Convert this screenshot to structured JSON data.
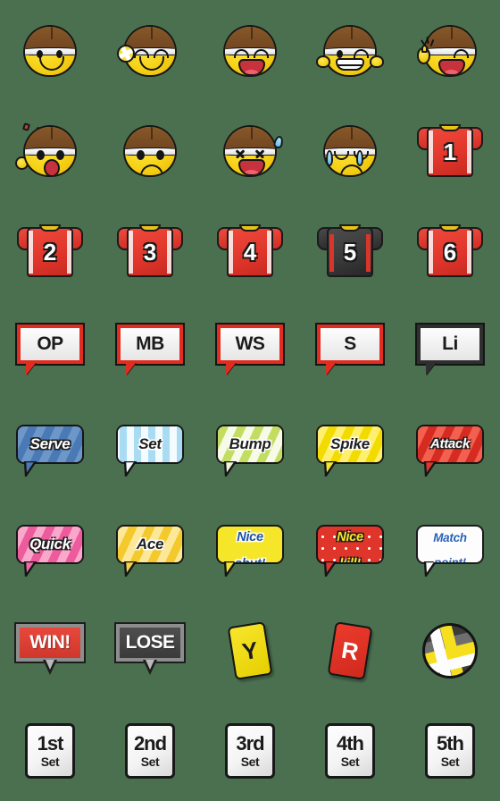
{
  "sheet": {
    "background_color": "#4a7050",
    "columns": 5,
    "rows": 8,
    "theme": "volleyball emoji sticker set"
  },
  "faces": [
    {
      "name": "smiling-player-face",
      "label": "smile"
    },
    {
      "name": "player-face-with-ball",
      "label": "wink with ball"
    },
    {
      "name": "laughing-player-face",
      "label": "laugh"
    },
    {
      "name": "grinning-player-face",
      "label": "grin fists"
    },
    {
      "name": "cheering-player-face",
      "label": "thumbs up wink"
    },
    {
      "name": "shouting-player-face",
      "label": "shout arm up"
    },
    {
      "name": "sad-player-face",
      "label": "sad"
    },
    {
      "name": "dizzy-player-face",
      "label": "dizzy"
    },
    {
      "name": "crying-player-face",
      "label": "cry"
    }
  ],
  "jerseys": [
    {
      "number": "1",
      "color": "red",
      "hex": "#e0352a"
    },
    {
      "number": "2",
      "color": "red",
      "hex": "#e0352a"
    },
    {
      "number": "3",
      "color": "red",
      "hex": "#e0352a"
    },
    {
      "number": "4",
      "color": "red",
      "hex": "#e0352a"
    },
    {
      "number": "5",
      "color": "black",
      "hex": "#3a3a3a"
    },
    {
      "number": "6",
      "color": "red",
      "hex": "#e0352a"
    }
  ],
  "positions": [
    {
      "label": "OP",
      "border": "#e12d20",
      "meaning": "opposite"
    },
    {
      "label": "MB",
      "border": "#e12d20",
      "meaning": "middle blocker"
    },
    {
      "label": "WS",
      "border": "#e12d20",
      "meaning": "wing spiker"
    },
    {
      "label": "S",
      "border": "#e12d20",
      "meaning": "setter"
    },
    {
      "label": "Li",
      "border": "#2f2f2f",
      "meaning": "libero"
    }
  ],
  "actions": [
    {
      "label": "Serve",
      "bg": "#4a7ab5",
      "stripe": "#6d97c9",
      "text": "#ffffff",
      "stripe_dir": "diagonal"
    },
    {
      "label": "Set",
      "bg": "#e9f4fb",
      "stripe": "#a9dcf3",
      "text": "#1f1f1f",
      "stripe_dir": "vertical"
    },
    {
      "label": "Bump",
      "bg": "#f3f8e2",
      "stripe": "#c3dd61",
      "text": "#1f1f1f",
      "stripe_dir": "diagonal"
    },
    {
      "label": "Spike",
      "bg": "#f6e62a",
      "stripe": "#ffef6e",
      "text": "#1f1f1f",
      "stripe_dir": "diagonal"
    },
    {
      "label": "Attack",
      "bg": "#e0352a",
      "stripe": "#f4604f",
      "text": "#ffffff",
      "stripe_dir": "diagonal"
    },
    {
      "label": "Quick",
      "bg": "#f06aa8",
      "stripe": "#f9a8cb",
      "text": "#ffffff",
      "stripe_dir": "diagonal"
    },
    {
      "label": "Ace",
      "bg": "#f6d24a",
      "stripe": "#fde89a",
      "text": "#1f1f1f",
      "stripe_dir": "diagonal"
    }
  ],
  "calls": [
    {
      "line1": "Nice",
      "line2": "shut!",
      "bg": "#f6e62a",
      "text": "#1d52a8",
      "dots": false
    },
    {
      "line1": "Nice",
      "line2": "kill!",
      "bg": "#e0352a",
      "text": "#f6e62a",
      "dots": true
    },
    {
      "line1": "Match",
      "line2": "point!",
      "bg": "#fdfdfd",
      "text": "#2a63b8",
      "dots": false
    }
  ],
  "results": [
    {
      "label": "WIN!",
      "style": "win",
      "bg": "#e8483c"
    },
    {
      "label": "LOSE",
      "style": "lose",
      "bg": "#3a3a3a"
    }
  ],
  "cards": [
    {
      "label": "Y",
      "color": "yellow",
      "hex": "#f8e62c",
      "meaning": "yellow card"
    },
    {
      "label": "R",
      "color": "red",
      "hex": "#ec3b2c",
      "meaning": "red card"
    }
  ],
  "ball": {
    "name": "volleyball",
    "colors": [
      "#3b3b3b",
      "#f5df1f",
      "#fdfdfd"
    ]
  },
  "sets": [
    {
      "ordinal": "1st",
      "word": "Set"
    },
    {
      "ordinal": "2nd",
      "word": "Set"
    },
    {
      "ordinal": "3rd",
      "word": "Set"
    },
    {
      "ordinal": "4th",
      "word": "Set"
    },
    {
      "ordinal": "5th",
      "word": "Set"
    }
  ]
}
